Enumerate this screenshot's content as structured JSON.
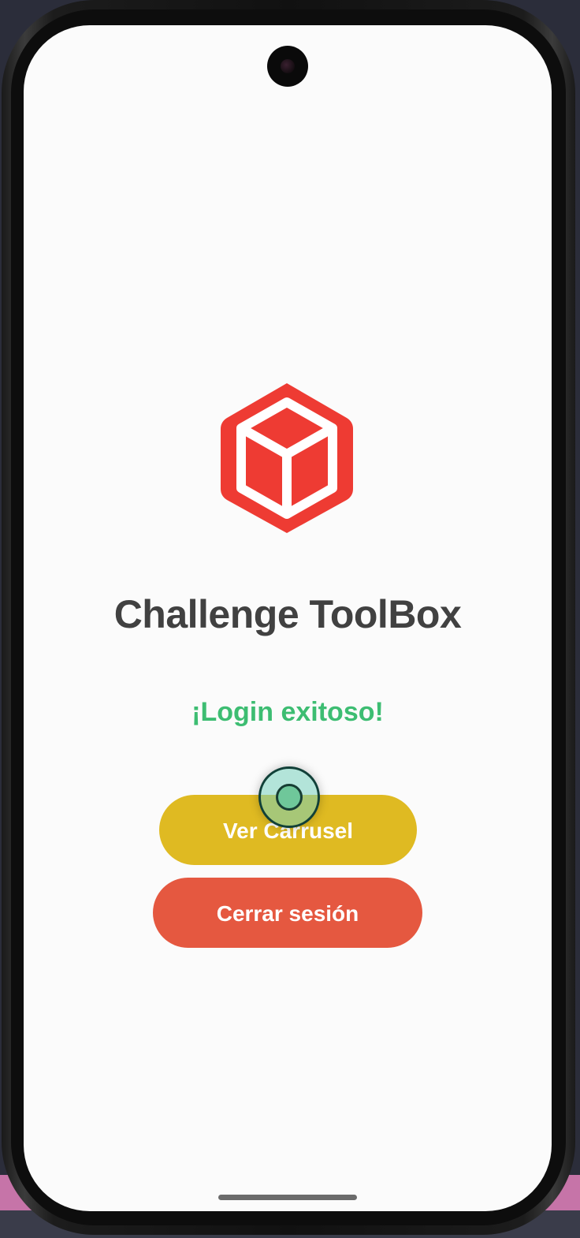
{
  "app": {
    "title": "Challenge ToolBox",
    "status_message": "¡Login exitoso!",
    "logo_icon": "cube-icon"
  },
  "buttons": {
    "carousel_label": "Ver Carrusel",
    "logout_label": "Cerrar sesión"
  },
  "colors": {
    "logo_red": "#ee3b33",
    "status_green": "#3dbd72",
    "carousel_button": "#dfba22",
    "logout_button": "#e55840",
    "title_text": "#414141"
  }
}
